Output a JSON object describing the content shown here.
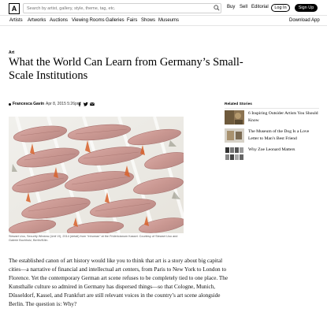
{
  "header": {
    "logo_letter": "A",
    "search_placeholder": "Search by artist, gallery, style, theme, tag, etc.",
    "nav": [
      "Buy",
      "Sell",
      "Editorial"
    ],
    "login_label": "Log In",
    "signup_label": "Sign Up"
  },
  "subnav": {
    "items": [
      "Artists",
      "Artworks",
      "Auctions",
      "Viewing Rooms",
      "Galleries",
      "Fairs",
      "Shows",
      "Museums"
    ],
    "download": "Download App"
  },
  "article": {
    "kicker": "Art",
    "headline": "What the World Can Learn from Germany’s Small-Scale Institutions",
    "author": "Francesca Gavin",
    "date": "Apr 8, 2015 5:26pm",
    "share_icons": [
      "facebook-icon",
      "twitter-icon",
      "email-icon"
    ],
    "caption": "Stewart Uoo, Security Window (Unit VI), 2014 (detail) from “Inhuman” at the Fridericianum Kassel. Courtesy of Stewart Uoo and Galerie Buchholz, Berlin/Köln.",
    "body": "The established canon of art history would like you to think that art is a story about big capital cities—a narrative of financial and intellectual art centers, from Paris to New York to London to Florence. Yet the contemporary German art scene refuses to be completely tied to one place. The Kunsthalle culture so admired in Germany has dispersed things—so that Cologne, Munich, Düsseldorf, Kassel, and Frankfurt are still relevant voices in the country’s art scene alongside Berlin. The question is: Why?"
  },
  "related": {
    "title": "Related Stories",
    "items": [
      {
        "title": "6 Inspiring Outsider Artists You Should Know"
      },
      {
        "title": "The Museum of the Dog Is a Love Letter to Man’s Best Friend"
      },
      {
        "title": "Why Zoe Leonard Matters"
      }
    ]
  },
  "colors": {
    "accent": "#000000",
    "border": "#e5e5e5",
    "muted_text": "#8a8a8a"
  }
}
